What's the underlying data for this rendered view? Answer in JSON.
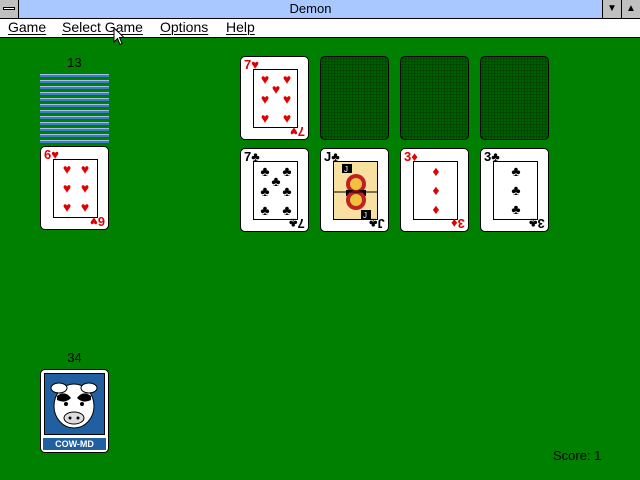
{
  "window": {
    "title": "Demon",
    "min_icon": "▼",
    "max_icon": "▲"
  },
  "menu": {
    "items": [
      {
        "label": "Game"
      },
      {
        "label": "Select Game"
      },
      {
        "label": "Options"
      },
      {
        "label": "Help"
      }
    ]
  },
  "reserve": {
    "count": "13",
    "top_card": {
      "rank": "6",
      "suit": "♥",
      "color": "red"
    }
  },
  "foundations": [
    {
      "rank": "7",
      "suit": "♥",
      "color": "red"
    },
    {
      "empty": true
    },
    {
      "empty": true
    },
    {
      "empty": true
    }
  ],
  "tableau": [
    {
      "rank": "7",
      "suit": "♣",
      "color": "black"
    },
    {
      "rank": "J",
      "suit": "♣",
      "color": "black"
    },
    {
      "rank": "3",
      "suit": "♦",
      "color": "red"
    },
    {
      "rank": "3",
      "suit": "♣",
      "color": "black"
    }
  ],
  "stock": {
    "count": "34",
    "back_caption": "COW-MD"
  },
  "status": {
    "score": "Score: 1"
  },
  "colors": {
    "felt": "#008000",
    "red_suit": "#e00000",
    "title_bar": "#a8c8ff"
  }
}
